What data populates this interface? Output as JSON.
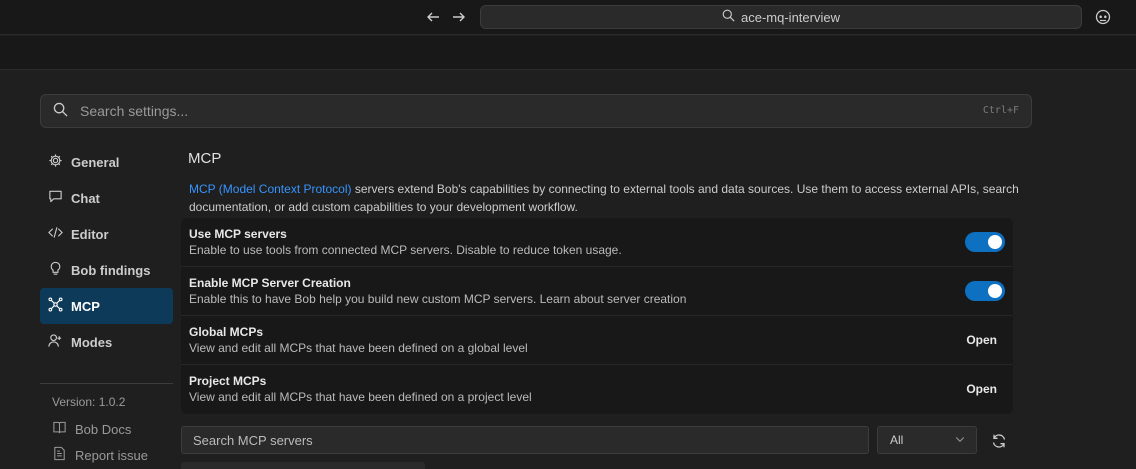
{
  "titlebar": {
    "command_center": "ace-mq-interview"
  },
  "settings": {
    "search_placeholder": "Search settings...",
    "search_shortcut": "Ctrl+F"
  },
  "sidebar": {
    "items": [
      {
        "label": "General",
        "icon": "gear-icon"
      },
      {
        "label": "Chat",
        "icon": "chat-icon"
      },
      {
        "label": "Editor",
        "icon": "code-icon"
      },
      {
        "label": "Bob findings",
        "icon": "lightbulb-icon"
      },
      {
        "label": "MCP",
        "icon": "mcp-icon",
        "active": true
      },
      {
        "label": "Modes",
        "icon": "modes-icon"
      }
    ],
    "version": "Version: 1.0.2",
    "links": [
      {
        "label": "Bob Docs",
        "icon": "book-icon"
      },
      {
        "label": "Report issue",
        "icon": "report-icon"
      }
    ]
  },
  "mcp": {
    "title": "MCP",
    "description_link": "MCP (Model Context Protocol)",
    "description_rest": " servers extend Bob's capabilities by connecting to external tools and data sources. Use them to access external APIs, search documentation, or add custom capabilities to your development workflow.",
    "rows": [
      {
        "title": "Use MCP servers",
        "subtitle": "Enable to use tools from connected MCP servers. Disable to reduce token usage.",
        "control": "toggle",
        "enabled": true
      },
      {
        "title": "Enable MCP Server Creation",
        "subtitle": "Enable this to have Bob help you build new custom MCP servers. Learn about server creation",
        "control": "toggle",
        "enabled": true
      },
      {
        "title": "Global MCPs",
        "subtitle": "View and edit all MCPs that have been defined on a global level",
        "control": "open",
        "action_label": "Open"
      },
      {
        "title": "Project MCPs",
        "subtitle": "View and edit all MCPs that have been defined on a project level",
        "control": "open",
        "action_label": "Open"
      }
    ],
    "server_search_placeholder": "Search MCP servers",
    "filter_value": "All"
  },
  "colors": {
    "accent": "#0e70c0",
    "link": "#3794ff",
    "active_nav": "#0e3a5a"
  }
}
